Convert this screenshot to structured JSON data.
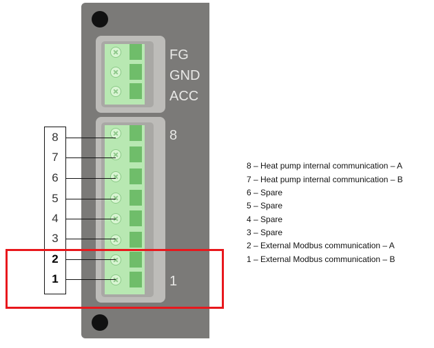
{
  "panel": {
    "top_labels": [
      "FG",
      "GND",
      "ACC"
    ],
    "pin_top_marker": "8",
    "pin_bottom_marker": "1"
  },
  "pins": [
    {
      "num": "8",
      "bold": false
    },
    {
      "num": "7",
      "bold": false
    },
    {
      "num": "6",
      "bold": false
    },
    {
      "num": "5",
      "bold": false
    },
    {
      "num": "4",
      "bold": false
    },
    {
      "num": "3",
      "bold": false
    },
    {
      "num": "2",
      "bold": true
    },
    {
      "num": "1",
      "bold": true
    }
  ],
  "legend": [
    "8 – Heat pump internal communication – A",
    "7 – Heat pump internal communication – B",
    "6 – Spare",
    "5 – Spare",
    "4 – Spare",
    "3 – Spare",
    "2 – External Modbus communication – A",
    "1 – External Modbus communication – B"
  ],
  "colors": {
    "panel": "#7b7a78",
    "terminal_green": "#b8e8b2",
    "highlight": "#e8171c"
  }
}
